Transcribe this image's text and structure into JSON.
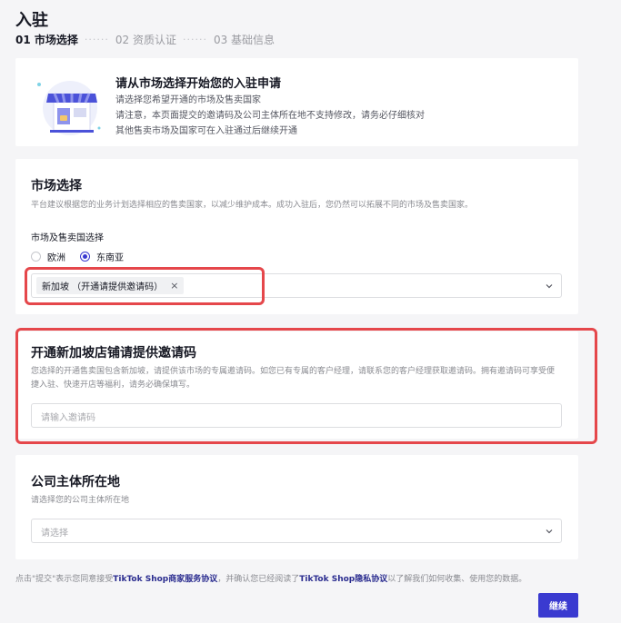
{
  "page": {
    "title": "入驻"
  },
  "steps": [
    {
      "label": "01 市场选择",
      "active": true
    },
    {
      "label": "02 资质认证",
      "active": false
    },
    {
      "label": "03 基础信息",
      "active": false
    }
  ],
  "step_separator": "······",
  "intro": {
    "title": "请从市场选择开始您的入驻申请",
    "lines": [
      "请选择您希望开通的市场及售卖国家",
      "请注意，本页面提交的邀请码及公司主体所在地不支持修改，请务必仔细核对",
      "其他售卖市场及国家可在入驻通过后继续开通"
    ]
  },
  "market": {
    "title": "市场选择",
    "description": "平台建议根据您的业务计划选择相应的售卖国家，以减少维护成本。成功入驻后，您仍然可以拓展不同的市场及售卖国家。",
    "field_label": "市场及售卖国选择",
    "radio_options": [
      {
        "label": "欧洲",
        "checked": false
      },
      {
        "label": "东南亚",
        "checked": true
      }
    ],
    "selected_chip": "新加坡 （开通请提供邀请码）",
    "chip_close": "×"
  },
  "invite": {
    "title": "开通新加坡店铺请提供邀请码",
    "description_lines": [
      "您选择的开通售卖国包含新加坡，请提供该市场的专属邀请码。如您已有专属的客户经理，请联系您的客户经理获取邀请码。拥有邀请码可享受便",
      "捷入驻、快速开店等福利，请务必确保填写。"
    ],
    "input_placeholder": "请输入邀请码"
  },
  "entity": {
    "title": "公司主体所在地",
    "description": "请选择您的公司主体所在地",
    "select_placeholder": "请选择"
  },
  "footer": {
    "text_prefix": "点击\"提交\"表示您同意接受",
    "link1": "TikTok Shop商家服务协议",
    "text_middle": "，并确认您已经阅读了",
    "link2": "TikTok Shop隐私协议",
    "text_suffix": "以了解我们如何收集、使用您的数据。"
  },
  "actions": {
    "continue_label": "继续"
  },
  "colors": {
    "primary": "#3a3ad0",
    "highlight": "#e5474b",
    "background": "#f5f5f7"
  }
}
